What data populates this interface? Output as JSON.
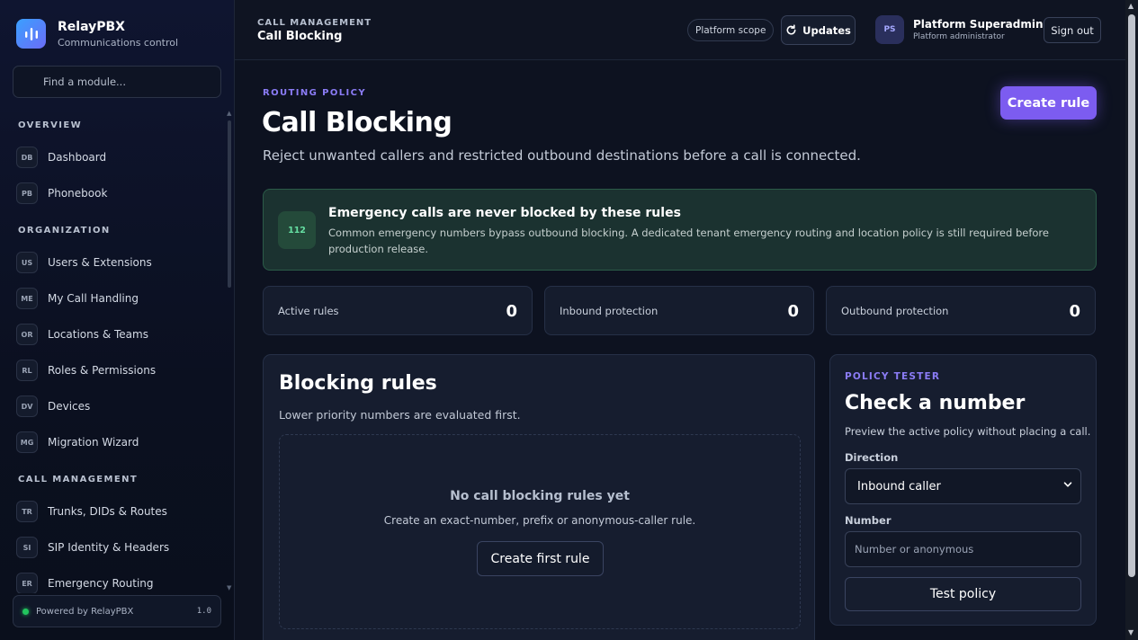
{
  "brand": {
    "name": "RelayPBX",
    "subtitle": "Communications control"
  },
  "sidebar": {
    "search_placeholder": "Find a module...",
    "sections": [
      {
        "title": "OVERVIEW",
        "items": [
          {
            "code": "DB",
            "label": "Dashboard"
          },
          {
            "code": "PB",
            "label": "Phonebook"
          }
        ]
      },
      {
        "title": "ORGANIZATION",
        "items": [
          {
            "code": "US",
            "label": "Users & Extensions"
          },
          {
            "code": "ME",
            "label": "My Call Handling"
          },
          {
            "code": "OR",
            "label": "Locations & Teams"
          },
          {
            "code": "RL",
            "label": "Roles & Permissions"
          },
          {
            "code": "DV",
            "label": "Devices"
          },
          {
            "code": "MG",
            "label": "Migration Wizard"
          }
        ]
      },
      {
        "title": "CALL MANAGEMENT",
        "items": [
          {
            "code": "TR",
            "label": "Trunks, DIDs & Routes"
          },
          {
            "code": "SI",
            "label": "SIP Identity & Headers"
          },
          {
            "code": "ER",
            "label": "Emergency Routing"
          }
        ]
      }
    ],
    "powered": "Powered by RelayPBX",
    "version": "1.0",
    "status_color": "#22c55e"
  },
  "topbar": {
    "section": "CALL MANAGEMENT",
    "title": "Call Blocking",
    "scope": "Platform scope",
    "updates": "Updates",
    "avatar": "PS",
    "user_name": "Platform Superadmin",
    "user_role": "Platform administrator",
    "sign_out": "Sign out"
  },
  "page": {
    "eyebrow": "ROUTING POLICY",
    "title": "Call Blocking",
    "subtitle": "Reject unwanted callers and restricted outbound destinations before a call is connected.",
    "create_rule": "Create rule",
    "accent": "#7c5cf0"
  },
  "emergency": {
    "badge": "112",
    "title": "Emergency calls are never blocked by these rules",
    "text": "Common emergency numbers bypass outbound blocking. A dedicated tenant emergency routing and location policy is still required before production release."
  },
  "stats": [
    {
      "label": "Active rules",
      "value": "0"
    },
    {
      "label": "Inbound protection",
      "value": "0"
    },
    {
      "label": "Outbound protection",
      "value": "0"
    }
  ],
  "rules": {
    "title": "Blocking rules",
    "subtitle": "Lower priority numbers are evaluated first.",
    "empty_title": "No call blocking rules yet",
    "empty_text": "Create an exact-number, prefix or anonymous-caller rule.",
    "create_first": "Create first rule"
  },
  "tester": {
    "eyebrow": "POLICY TESTER",
    "title": "Check a number",
    "subtitle": "Preview the active policy without placing a call.",
    "direction_label": "Direction",
    "direction_value": "Inbound caller",
    "number_label": "Number",
    "number_placeholder": "Number or anonymous",
    "test_button": "Test policy"
  }
}
